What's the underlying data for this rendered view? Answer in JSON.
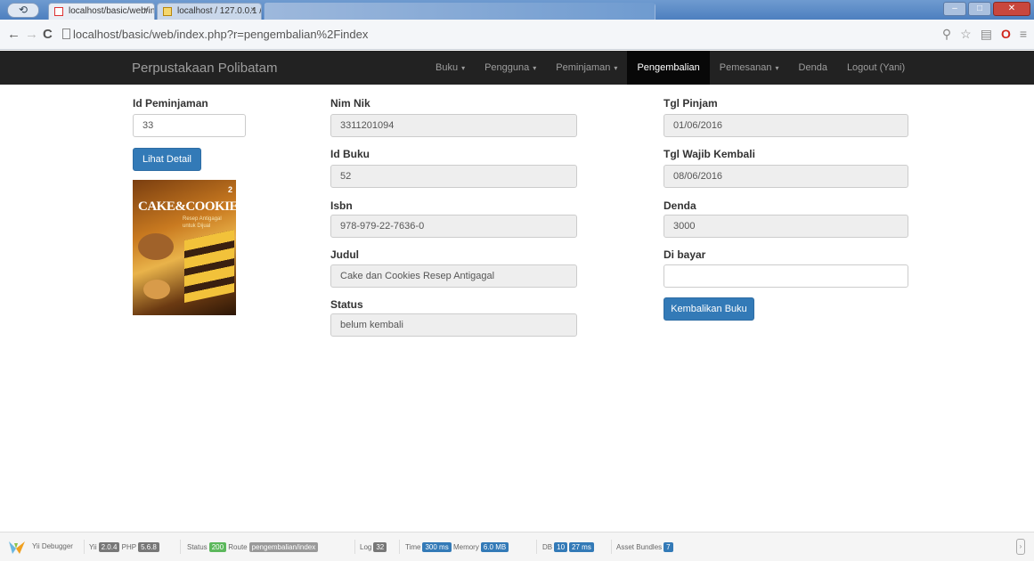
{
  "browser": {
    "tabs": [
      {
        "title": "localhost/basic/web/inde",
        "close": "×"
      },
      {
        "title": "localhost / 127.0.0.1 / pe",
        "close": "×"
      },
      {
        "title": ""
      }
    ],
    "url": "localhost/basic/web/index.php?r=pengembalian%2Findex"
  },
  "navbar": {
    "brand": "Perpustakaan Polibatam",
    "items": [
      {
        "label": "Buku",
        "caret": "▾"
      },
      {
        "label": "Pengguna",
        "caret": "▾"
      },
      {
        "label": "Peminjaman",
        "caret": "▾"
      },
      {
        "label": "Pengembalian",
        "active": true
      },
      {
        "label": "Pemesanan",
        "caret": "▾"
      },
      {
        "label": "Denda"
      },
      {
        "label": "Logout (Yani)"
      }
    ]
  },
  "form": {
    "id_peminjaman": {
      "label": "Id Peminjaman",
      "value": "33"
    },
    "lihat_detail": "Lihat Detail",
    "cover": {
      "title": "CAKE&COOKIES",
      "subtitle1": "Resep Antigagal",
      "subtitle2": "untuk Dijual",
      "num": "2"
    },
    "nim_nik": {
      "label": "Nim Nik",
      "value": "3311201094"
    },
    "id_buku": {
      "label": "Id Buku",
      "value": "52"
    },
    "isbn": {
      "label": "Isbn",
      "value": "978-979-22-7636-0"
    },
    "judul": {
      "label": "Judul",
      "value": "Cake dan Cookies Resep Antigagal"
    },
    "status": {
      "label": "Status",
      "value": "belum kembali"
    },
    "tgl_pinjam": {
      "label": "Tgl Pinjam",
      "value": "01/06/2016"
    },
    "tgl_wajib_kembali": {
      "label": "Tgl Wajib Kembali",
      "value": "08/06/2016"
    },
    "denda": {
      "label": "Denda",
      "value": "3000"
    },
    "di_bayar": {
      "label": "Di bayar",
      "value": ""
    },
    "kembalikan": "Kembalikan Buku"
  },
  "debug": {
    "yii": "Yii Debugger",
    "yii_label": "Yii",
    "yii_version": "2.0.4",
    "php_label": "PHP",
    "php_version": "5.6.8",
    "status_label": "Status",
    "status": "200",
    "route_label": "Route",
    "route": "pengembalian/index",
    "log_label": "Log",
    "log": "32",
    "time_label": "Time",
    "time": "300 ms",
    "memory_label": "Memory",
    "memory": "6.0 MB",
    "db_label": "DB",
    "db_count": "10",
    "db_time": "27 ms",
    "asset_label": "Asset Bundles",
    "asset": "7"
  }
}
